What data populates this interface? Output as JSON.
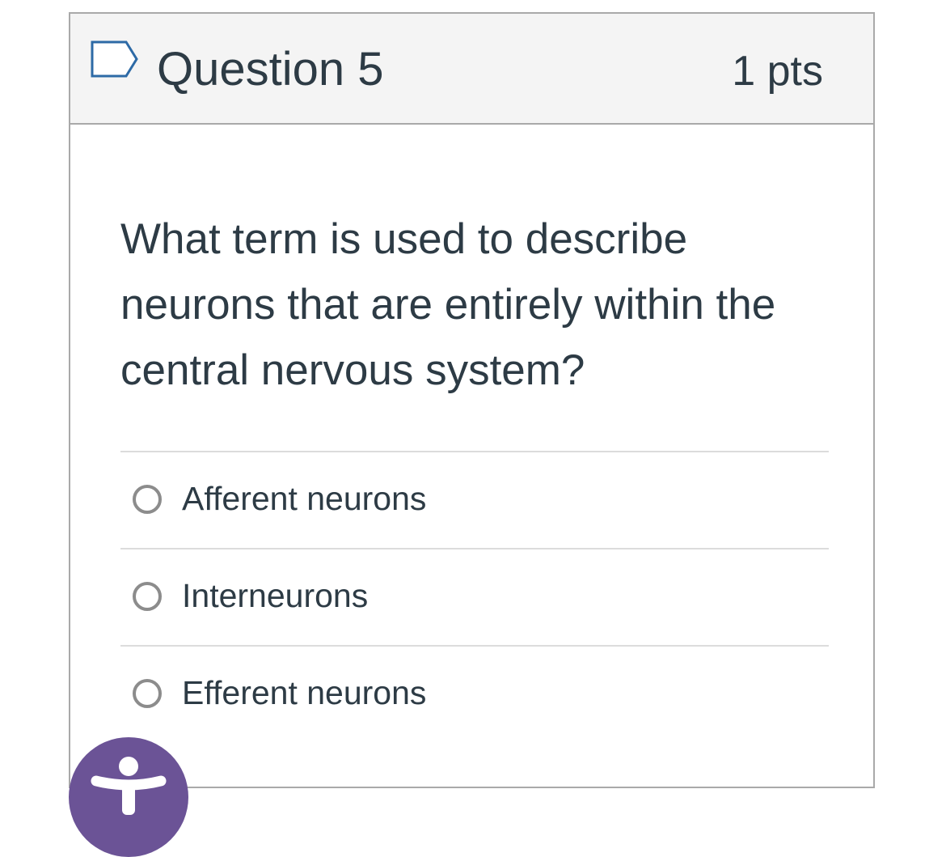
{
  "question": {
    "title": "Question 5",
    "points": "1 pts",
    "text": "What term is used to describe neurons that are entirely within the central nervous system?",
    "flag_icon": "flag-outline-icon"
  },
  "answers": [
    {
      "label": "Afferent neurons",
      "selected": false
    },
    {
      "label": "Interneurons",
      "selected": false
    },
    {
      "label": "Efferent neurons",
      "selected": false
    }
  ],
  "accessibility_button": {
    "icon": "accessibility-person-icon",
    "color": "#6b5396"
  },
  "colors": {
    "text": "#2d3b45",
    "header_bg": "#f4f4f4",
    "border": "#a9a9a9",
    "divider": "#dcdcdc",
    "radio_border": "#8c8c8c",
    "flag": "#2d6aa6"
  }
}
